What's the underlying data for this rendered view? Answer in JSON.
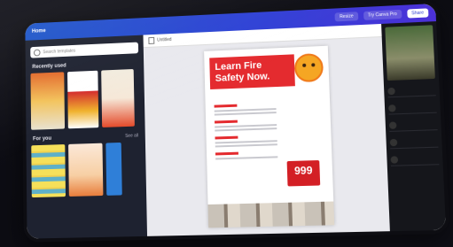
{
  "topbar": {
    "home_label": "Home",
    "resize_label": "Resize",
    "try_pro_label": "Try Canva Pro",
    "share_label": "Share"
  },
  "sidebar": {
    "search_placeholder": "Search templates",
    "recent_label": "Recently used",
    "for_you_label": "For you",
    "see_all_label": "See all"
  },
  "editor": {
    "doc_title": "Untitled",
    "banner_text": "Learn Fire Safety Now.",
    "emergency_number": "999"
  },
  "colors": {
    "accent": "#2f3fd6",
    "poster_red": "#e42b2f"
  }
}
